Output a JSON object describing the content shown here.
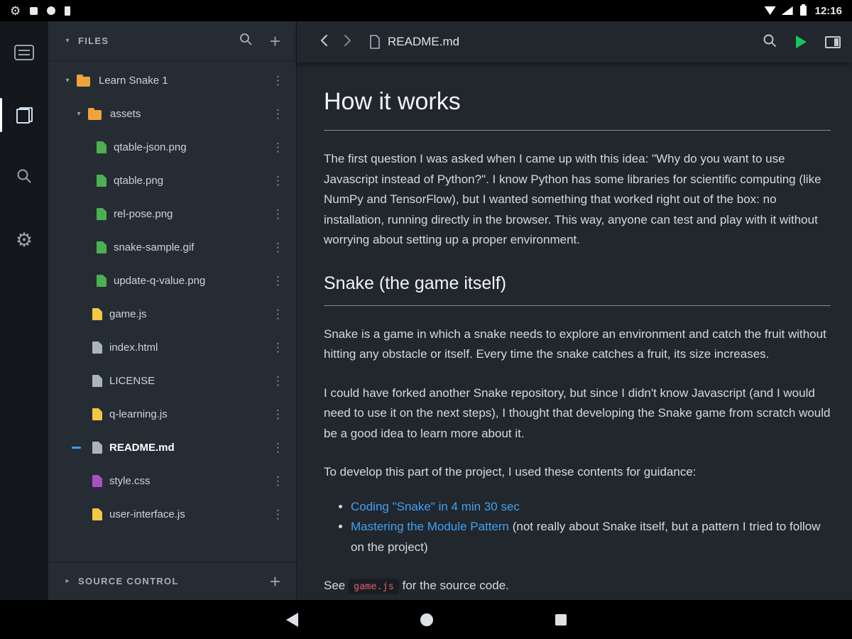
{
  "status_bar": {
    "time": "12:16"
  },
  "sidebar": {
    "header": {
      "title": "FILES"
    },
    "tree": [
      {
        "label": "Learn Snake 1",
        "type": "folder",
        "expanded": true
      },
      {
        "label": "assets",
        "type": "folder",
        "expanded": true
      },
      {
        "label": "qtable-json.png",
        "type": "image"
      },
      {
        "label": "qtable.png",
        "type": "image"
      },
      {
        "label": "rel-pose.png",
        "type": "image"
      },
      {
        "label": "snake-sample.gif",
        "type": "image"
      },
      {
        "label": "update-q-value.png",
        "type": "image"
      },
      {
        "label": "game.js",
        "type": "javascript"
      },
      {
        "label": "index.html",
        "type": "plain"
      },
      {
        "label": "LICENSE",
        "type": "plain"
      },
      {
        "label": "q-learning.js",
        "type": "javascript"
      },
      {
        "label": "README.md",
        "type": "plain",
        "active": true
      },
      {
        "label": "style.css",
        "type": "css"
      },
      {
        "label": "user-interface.js",
        "type": "javascript"
      }
    ],
    "source_control": {
      "title": "SOURCE CONTROL"
    }
  },
  "editor": {
    "title": "README.md",
    "doc": {
      "h1": "How it works",
      "p1": "The first question I was asked when I came up with this idea: \"Why do you want to use Javascript instead of Python?\". I know Python has some libraries for scientific computing (like NumPy and TensorFlow), but I wanted something that worked right out of the box: no installation, running directly in the browser. This way, anyone can test and play with it without worrying about setting up a proper environment.",
      "h2": "Snake (the game itself)",
      "p2": "Snake is a game in which a snake needs to explore an environment and catch the fruit without hitting any obstacle or itself. Every time the snake catches a fruit, its size increases.",
      "p3": "I could have forked another Snake repository, but since I didn't know Javascript (and I would need to use it on the next steps), I thought that developing the Snake game from scratch would be a good idea to learn more about it.",
      "p4": "To develop this part of the project, I used these contents for guidance:",
      "bullet1_link": "Coding \"Snake\" in 4 min 30 sec",
      "bullet2_link": "Mastering the Module Pattern",
      "bullet2_rest": " (not really about Snake itself, but a pattern I tried to follow on the project)",
      "see_prefix": "See ",
      "see_code": "game.js",
      "see_suffix": " for the source code."
    }
  },
  "colors": {
    "accent_link": "#3da2f5",
    "play_green": "#12c662",
    "folder_orange": "#f0a33a",
    "file_image_green": "#4caf50",
    "file_js_yellow": "#f2c744",
    "file_css_purple": "#a94fc4",
    "file_plain_gray": "#aab4bd",
    "inline_code_red": "#e25d6a",
    "active_file_blue": "#3d9df2"
  }
}
